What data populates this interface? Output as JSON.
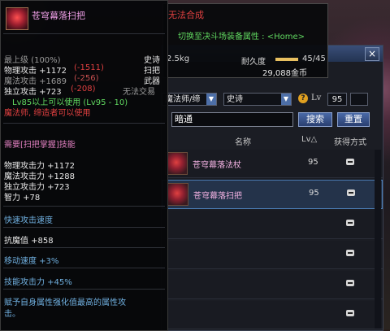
{
  "item_tooltip": {
    "name": "苍穹幕落扫把",
    "icon": "broom-item-icon",
    "rarity_line": {
      "left": "最上级 (100%)",
      "right": "史诗"
    },
    "stats": [
      {
        "label": "物理攻击 +1172",
        "delta": "(-1511)",
        "tag": "扫把"
      },
      {
        "label": "魔法攻击 +1689",
        "delta": "(-256)",
        "tag": "武器"
      },
      {
        "label": "独立攻击 +723",
        "delta": "(-208)",
        "tag": "无法交易"
      }
    ],
    "level_req": "Lv85以上可以使用 (Lv95 - 10)",
    "class_req": "魔法师, 缔造者可以使用",
    "skill_req": "需要[扫把掌握]技能",
    "bonus_stats": [
      "物理攻击力 +1172",
      "魔法攻击力 +1288",
      "独立攻击力 +723",
      "智力 +78"
    ],
    "attack_speed": "快速攻击速度",
    "anti_magic": "抗魔值 +858",
    "move_speed": "移动速度 +3%",
    "skill_attack": "技能攻击力 +45%",
    "desc_line1": "赋予自身属性强化值最高的属性攻",
    "desc_line2": "击。"
  },
  "detail_tooltip": {
    "title": "无法合成",
    "switch_text": "切换至决斗场装备属性 : <Home>",
    "weight": "2.5kg",
    "durability_label": "耐久度",
    "durability_value": "45/45",
    "durability_fraction": 1.0,
    "price": "29,088金币"
  },
  "shop": {
    "close_label": "×",
    "filters": {
      "class": "魔法师/缔",
      "rarity": "史诗",
      "lv_label": "Lv",
      "lv_value": "95",
      "lv_value2": ""
    },
    "search": {
      "value": "暗通",
      "button": "搜索",
      "reset": "重置"
    },
    "columns": {
      "name": "名称",
      "lv": "Lv△",
      "acquire": "获得方式"
    },
    "rows": [
      {
        "name": "苍穹幕落法杖",
        "lv": "95"
      },
      {
        "name": "苍穹幕落扫把",
        "lv": "95"
      },
      {
        "name": "",
        "lv": ""
      },
      {
        "name": "",
        "lv": ""
      },
      {
        "name": "",
        "lv": ""
      },
      {
        "name": "",
        "lv": ""
      }
    ]
  }
}
